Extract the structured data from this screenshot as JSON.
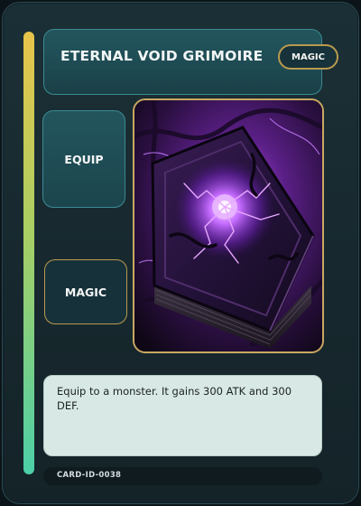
{
  "card": {
    "title": "ETERNAL VOID GRIMOIRE",
    "type_badge": "MAGIC",
    "tiles": {
      "equip_label": "EQUIP",
      "magic_label": "MAGIC"
    },
    "artwork_icon": "dark-spellbook-artwork",
    "effect_text": "Equip to a monster. It gains 300 ATK and 300 DEF.",
    "card_id": "CARD-ID-0038"
  },
  "colors": {
    "card_background": "#17292f",
    "panel_teal": "#1e4a52",
    "panel_border": "#3b8a93",
    "gold_border": "#b99a4e",
    "accent_bar_top": "#e8c44a",
    "accent_bar_bottom": "#4ccfa8",
    "text_box": "#d8e8e4",
    "art_purple_glow": "#b155f5"
  }
}
